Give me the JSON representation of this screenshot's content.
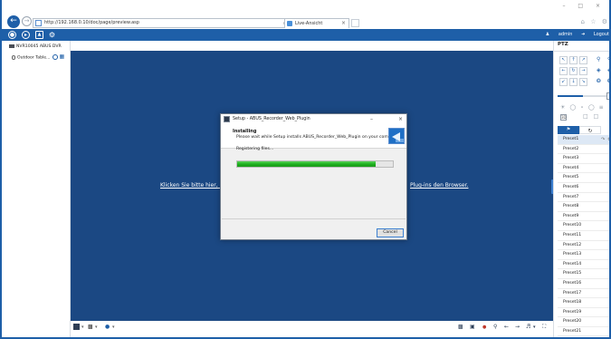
{
  "browser": {
    "url": "http://192.168.0.10/doc/page/preview.asp",
    "url_tools": "⌕ ▾ ↻",
    "tab_label": "Live-Ansicht",
    "tab_close": "×",
    "window_controls": "– □ ×",
    "toolbar_icons": "⌂ ☆ ⚙"
  },
  "app": {
    "user": "admin",
    "logout": "Logout",
    "accent_color": "#1e5fa8",
    "nav_icons": [
      "live-view-icon",
      "playback-icon",
      "picture-icon",
      "configuration-icon"
    ]
  },
  "devices": {
    "device_name": "NVR10045 ABUS DVR",
    "camera_name": "Outdoor Table..."
  },
  "liveview": {
    "hint_left": "Klicken Sie bitte hier, um",
    "hint_right": "Plug-ins den Browser."
  },
  "dialog": {
    "title": "Setup - ABUS_Recorder_Web_Plugin",
    "min_glyph": "–",
    "close_glyph": "×",
    "heading": "Installing",
    "subheading": "Please wait while Setup installs ABUS_Recorder_Web_Plugin on your computer.",
    "status": "Registering files...",
    "progress": 0.89,
    "cancel_label": "Cancel"
  },
  "ptz": {
    "title": "PTZ",
    "presets_tab_icon": "preset-icon",
    "patrol_tab_icon": "patrol-icon",
    "presets": [
      "Preset1",
      "Preset2",
      "Preset3",
      "Preset4",
      "Preset5",
      "Preset6",
      "Preset7",
      "Preset8",
      "Preset9",
      "Preset10",
      "Preset11",
      "Preset12",
      "Preset13",
      "Preset14",
      "Preset15",
      "Preset16",
      "Preset17",
      "Preset18",
      "Preset19",
      "Preset20",
      "Preset21"
    ]
  }
}
